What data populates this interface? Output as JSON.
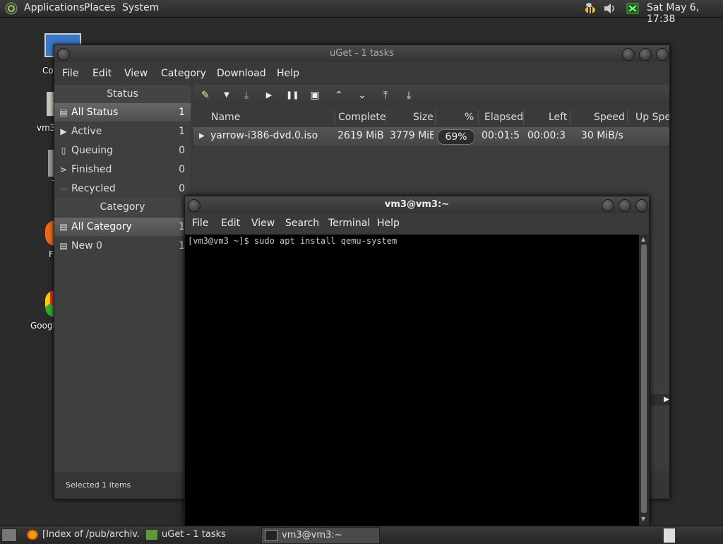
{
  "top_panel": {
    "menus": [
      "Applications",
      "Places",
      "System"
    ],
    "clock": "Sat May  6, 17:38",
    "icons": [
      "gnome-foot-icon",
      "bee-icon",
      "volume-icon",
      "network-icon"
    ]
  },
  "desktop": {
    "icons": [
      {
        "label": "Co",
        "icon": "computer-icon"
      },
      {
        "label": "vm3",
        "icon": "home-folder-icon"
      },
      {
        "label": "T",
        "icon": "trash-icon"
      },
      {
        "label": "F",
        "icon": "firefox-icon"
      },
      {
        "label": "Googl",
        "icon": "chrome-icon"
      }
    ]
  },
  "uget": {
    "title": "uGet - 1 tasks",
    "menus": [
      "File",
      "Edit",
      "View",
      "Category",
      "Download",
      "Help"
    ],
    "status_header": "Status",
    "status_items": [
      {
        "label": "All Status",
        "count": "1",
        "icon": "all-status-icon"
      },
      {
        "label": "Active",
        "count": "1",
        "icon": "play-icon"
      },
      {
        "label": "Queuing",
        "count": "0",
        "icon": "queue-icon"
      },
      {
        "label": "Finished",
        "count": "0",
        "icon": "finished-icon"
      },
      {
        "label": "Recycled",
        "count": "0",
        "icon": "recycled-icon"
      }
    ],
    "category_header": "Category",
    "category_items": [
      {
        "label": "All Category",
        "count": "1",
        "icon": "all-category-icon"
      },
      {
        "label": "New 0",
        "count": "1",
        "icon": "category-icon"
      }
    ],
    "columns": [
      "Name",
      "Complete",
      "Size",
      "%",
      "Elapsed",
      "Left",
      "Speed",
      "Up Spe"
    ],
    "row": {
      "name": "yarrow-i386-dvd.0.iso",
      "complete": "2619 MiB",
      "size": "3779 MiB",
      "percent": "69%",
      "elapsed": "00:01:5",
      "left": "00:00:3",
      "speed": "30 MiB/s"
    },
    "status_text": "Selected 1 items"
  },
  "terminal": {
    "title": "vm3@vm3:~",
    "menus": [
      "File",
      "Edit",
      "View",
      "Search",
      "Terminal",
      "Help"
    ],
    "line": "[vm3@vm3 ~]$ sudo apt install qemu-system"
  },
  "taskbar": {
    "tasks": [
      {
        "label": "[Index of /pub/archiv...",
        "icon": "firefox-icon"
      },
      {
        "label": "uGet - 1 tasks",
        "icon": "uget-icon"
      },
      {
        "label": "vm3@vm3:~",
        "icon": "terminal-icon"
      }
    ]
  }
}
